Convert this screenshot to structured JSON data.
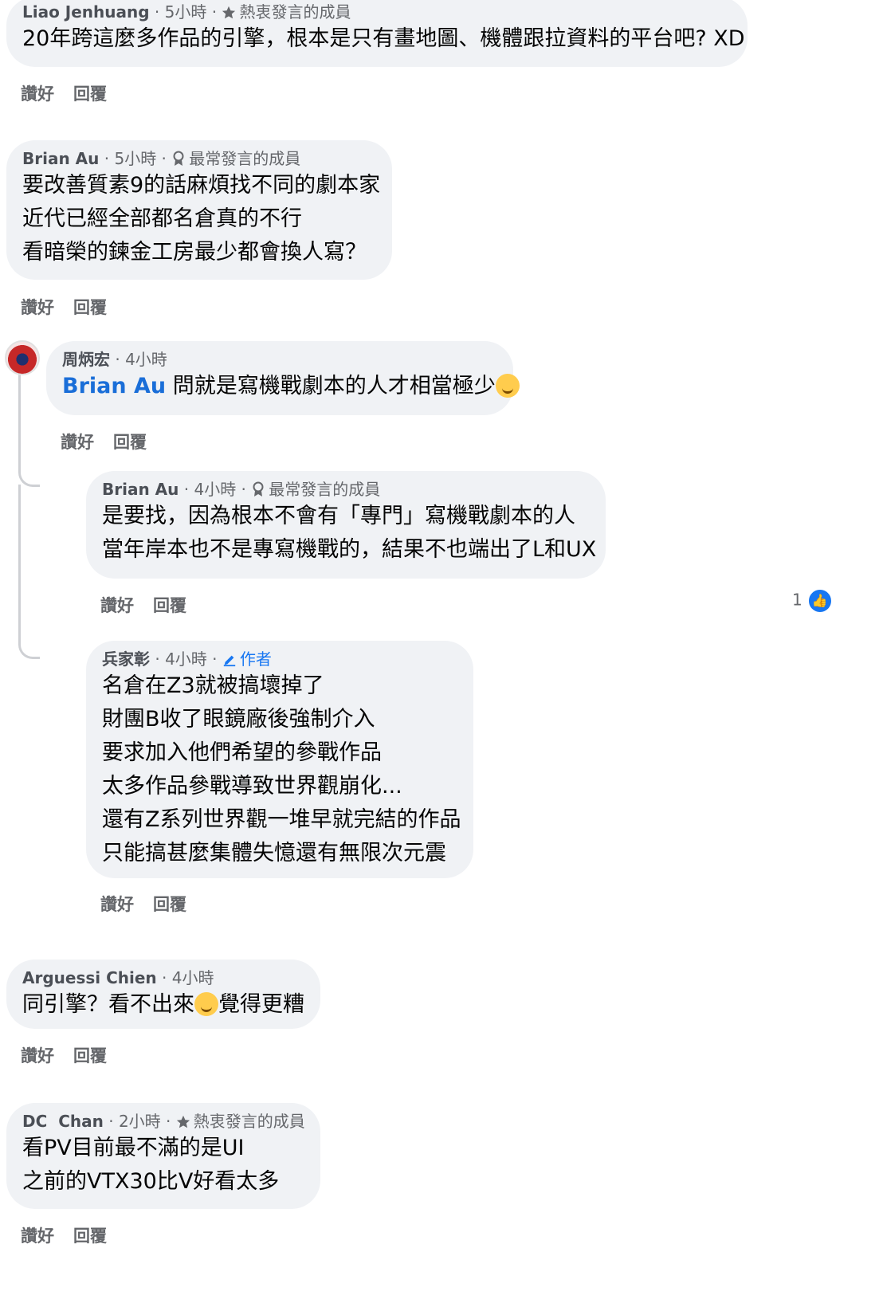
{
  "comments": [
    {
      "author": "Liao Jenhuang",
      "time": "5小時",
      "badge": "熱衷發言的成員",
      "badge_icon": "star-icon",
      "lines": [
        "20年跨這麼多作品的引擎，根本是只有畫地圖、機體跟拉資料的平台吧? XD"
      ],
      "like": "讚好",
      "reply": "回覆"
    },
    {
      "author": "Brian Au",
      "time": "5小時",
      "badge": "最常發言的成員",
      "badge_icon": "award-icon",
      "lines": [
        "要改善質素9的話麻煩找不同的劇本家",
        "近代已經全部都名倉真的不行",
        "看暗榮的鍊金工房最少都會換人寫？"
      ],
      "like": "讚好",
      "reply": "回覆"
    },
    {
      "author": "周炳宏",
      "time": "4小時",
      "mention": "Brian Au",
      "text": "問就是寫機戰劇本的人才相當極少",
      "like": "讚好",
      "reply": "回覆"
    },
    {
      "author": "Brian Au",
      "time": "4小時",
      "badge": "最常發言的成員",
      "badge_icon": "award-icon",
      "lines": [
        "是要找，因為根本不會有「專門」寫機戰劇本的人",
        "當年岸本也不是專寫機戰的，結果不也端出了L和UX"
      ],
      "like": "讚好",
      "reply": "回覆",
      "reaction_count": "1"
    },
    {
      "author": "兵家彰",
      "time": "4小時",
      "badge": "作者",
      "badge_icon": "pencil-icon",
      "lines": [
        "名倉在Z3就被搞壞掉了",
        "財團B收了眼鏡廠後強制介入",
        "要求加入他們希望的參戰作品",
        "太多作品參戰導致世界觀崩化...",
        "還有Z系列世界觀一堆早就完結的作品",
        "只能搞甚麼集體失憶還有無限次元震"
      ],
      "like": "讚好",
      "reply": "回覆"
    },
    {
      "author": "Arguessi Chien",
      "time": "4小時",
      "text_before": "同引擎？看不出來",
      "text_after": "覺得更糟",
      "like": "讚好",
      "reply": "回覆"
    },
    {
      "author": "DC  Chan",
      "time": "2小時",
      "badge": "熱衷發言的成員",
      "badge_icon": "star-icon",
      "lines": [
        "看PV目前最不滿的是UI",
        "之前的VTX30比V好看太多"
      ],
      "like": "讚好",
      "reply": "回覆"
    }
  ]
}
